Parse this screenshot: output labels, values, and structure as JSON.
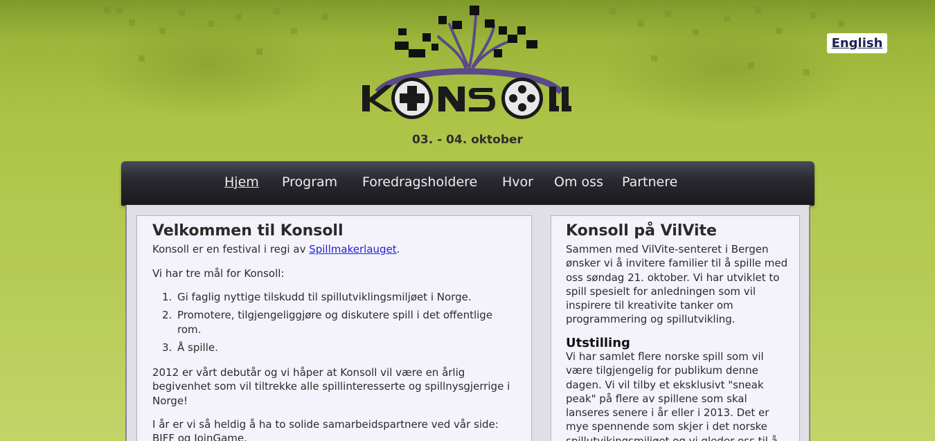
{
  "lang_switch": {
    "label": "English"
  },
  "header": {
    "logo_text": "KONSOLL",
    "dates": "03. - 04. oktober"
  },
  "nav": {
    "items": [
      {
        "label": "Hjem",
        "active": true
      },
      {
        "label": "Program"
      },
      {
        "label": "Foredragsholdere"
      },
      {
        "label": "Hvor"
      },
      {
        "label": "Om oss"
      },
      {
        "label": "Partnere"
      }
    ]
  },
  "left": {
    "title": "Velkommen til Konsoll",
    "intro_prefix": "Konsoll er en festival i regi av ",
    "intro_link": "Spillmakerlauget",
    "intro_suffix": ".",
    "goals_intro": "Vi har tre mål for Konsoll:",
    "goals": [
      {
        "num": "1.",
        "text": "Gi faglig nyttige tilskudd til spillutviklingsmiljøet i Norge."
      },
      {
        "num": "2.",
        "text": "Promotere, tilgjengeliggjøre og diskutere spill i det offentlige rom."
      },
      {
        "num": "3.",
        "text": "Å spille."
      }
    ],
    "debut_text": "2012 er vårt debutår og vi håper at Konsoll vil være en årlig begivenhet som vil tiltrekke alle spillinteresserte og spillnysgjerrige i Norge!",
    "partners_text": "I år er vi så heldig å ha to solide samarbeidspartnere ved vår side: BIFF og JoinGame."
  },
  "right": {
    "title": "Konsoll på VilVite",
    "intro": "Sammen med VilVite-senteret i Bergen ønsker vi å invitere familier til å spille med oss søndag 21. oktober. Vi har utviklet to spill spesielt for anledningen som vil inspirere til kreativite tanker om programmering og spillutvikling.",
    "section_title": "Utstilling",
    "section_text": "Vi har samlet flere norske spill som vil være tilgjengelig for publikum denne dagen. Vi vil tilby et eksklusivt \"sneak peak\" på flere av spillene som skal lanseres senere i år eller i 2013. Det er mye spennende som skjer i det norske spillutvikingsmiljøet og vi gleder oss til å"
  },
  "colors": {
    "background": "#adc447",
    "nav": "#1e1e24",
    "panel": "#f4f3fb",
    "logo_purple": "#5a4a8a",
    "link": "#1f1fd8"
  }
}
